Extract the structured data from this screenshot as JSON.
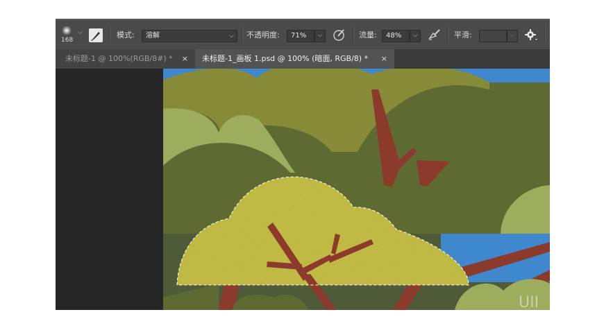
{
  "options_bar": {
    "brush_size": "168",
    "mode_label": "模式:",
    "mode_value": "溶解",
    "opacity_label": "不透明度:",
    "opacity_value": "71%",
    "flow_label": "流量:",
    "flow_value": "48%",
    "smoothing_label": "平滑:",
    "smoothing_value": ""
  },
  "tabs": [
    {
      "label": "未标题-1 @ 100%(RGB/8#) *",
      "close": "×",
      "active": false
    },
    {
      "label": "未标题-1_画板 1.psd @ 100% (暗面, RGB/8) *",
      "close": "×",
      "active": true
    }
  ],
  "canvas": {
    "watermark": "UII"
  },
  "colors": {
    "sky": "#3f88cd",
    "olive_dark": "#5d6b33",
    "olive_mid": "#878b37",
    "olive_light": "#9dad5d",
    "forest": "#4f5a38",
    "trunk": "#8b3a2c",
    "selection_fill": "#c4bd45"
  }
}
